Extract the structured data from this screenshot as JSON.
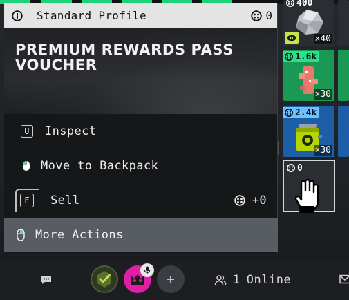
{
  "panel": {
    "header": {
      "title": "Standard Profile",
      "balance": "0",
      "info_icon": "info-circle-icon",
      "currency_icon": "currency-token-icon"
    },
    "item_name": "PREMIUM REWARDS PASS VOUCHER",
    "actions": [
      {
        "key": "U",
        "label": "Inspect",
        "icon": "keycap-icon"
      },
      {
        "label": "Move to Backpack",
        "icon": "mouse-left-click-icon"
      },
      {
        "key": "F",
        "label": "Sell",
        "icon": "keycap-icon",
        "price": "+0"
      },
      {
        "label": "More Actions",
        "icon": "mouse-right-click-icon"
      }
    ]
  },
  "inventory": {
    "slots": [
      {
        "price": "400",
        "qty": "×40"
      },
      {
        "price": "1.6k",
        "qty": "×30"
      },
      {
        "price": "2.4k",
        "qty": "×30"
      },
      {
        "price": "0"
      }
    ]
  },
  "bottombar": {
    "online_count": "1",
    "online_label": "Online",
    "icons": [
      "chat-icon",
      "users-icon",
      "mail-icon",
      "microphone-icon",
      "plus-icon"
    ]
  },
  "colors": {
    "header_bg": "#e4e4e4",
    "panel_bg": "#151719",
    "highlight_bg": "#585c63",
    "rarity_green": "#2be08a",
    "rarity_blue": "#6cc2ff",
    "avatar_pink": "#e01fa4"
  }
}
